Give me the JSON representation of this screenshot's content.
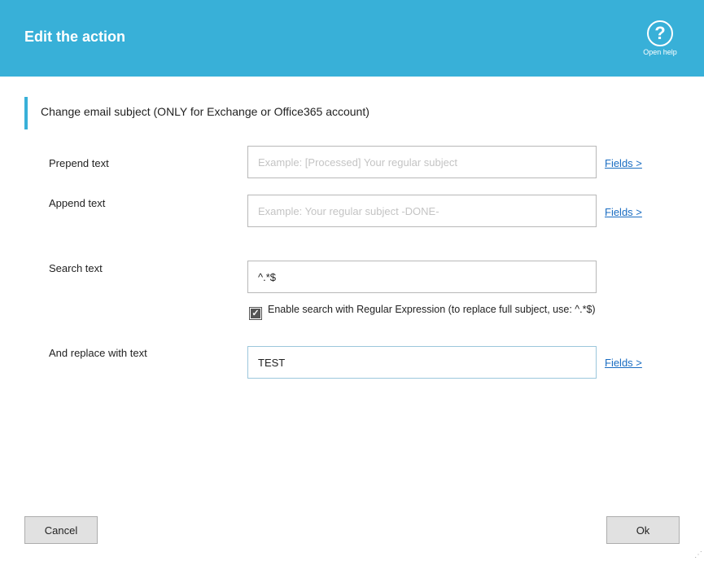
{
  "header": {
    "title": "Edit the action",
    "help_label": "Open help",
    "help_icon": "question-circle-icon"
  },
  "section": {
    "title": "Change email subject (ONLY for Exchange or Office365 account)"
  },
  "form": {
    "prepend": {
      "label": "Prepend text",
      "value": "",
      "placeholder": "Example: [Processed] Your regular subject",
      "fields_link": "Fields >"
    },
    "append": {
      "label": "Append text",
      "value": "",
      "placeholder": "Example: Your regular subject -DONE-",
      "fields_link": "Fields >"
    },
    "search": {
      "label": "Search text",
      "value": "^.*$"
    },
    "regex": {
      "checked": true,
      "label": "Enable search with Regular Expression (to replace full subject, use: ^.*$)"
    },
    "replace": {
      "label": "And replace with text",
      "value": "TEST",
      "fields_link": "Fields >"
    }
  },
  "buttons": {
    "cancel": "Cancel",
    "ok": "Ok"
  },
  "colors": {
    "header": "#38b0d8",
    "link": "#1a6dc2"
  }
}
